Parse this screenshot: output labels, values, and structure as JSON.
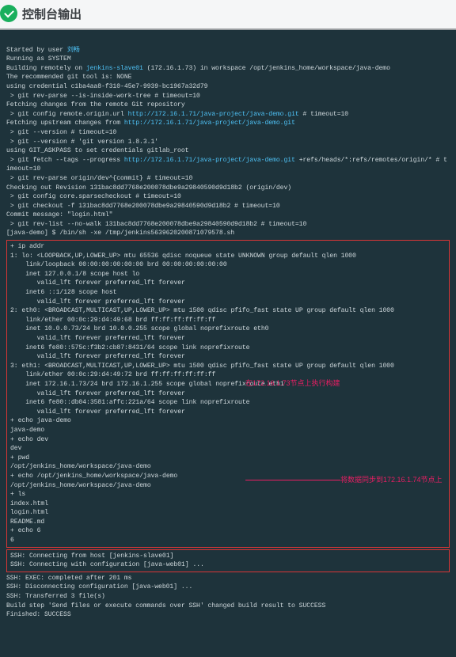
{
  "header": {
    "title": "控制台输出"
  },
  "console": {
    "l1a": "Started by user ",
    "l1b": "刘畅",
    "l2": "Running as SYSTEM",
    "l3a": "Building remotely on ",
    "l3b": "jenkins-slave01",
    "l3c": " (172.16.1.73) in workspace /opt/jenkins_home/workspace/java-demo",
    "l4": "The recommended git tool is: NONE",
    "l5": "using credential c1ba4aa8-f310-45e7-9939-bc1967a32d79",
    "l6": " > git rev-parse --is-inside-work-tree # timeout=10",
    "l7": "Fetching changes from the remote Git repository",
    "l8a": " > git config remote.origin.url ",
    "l8b": "http://172.16.1.71/java-project/java-demo.git",
    "l8c": " # timeout=10",
    "l9a": "Fetching upstream changes from ",
    "l9b": "http://172.16.1.71/java-project/java-demo.git",
    "l10": " > git --version # timeout=10",
    "l11": " > git --version # 'git version 1.8.3.1'",
    "l12": "using GIT_ASKPASS to set credentials gitlab_root",
    "l13a": " > git fetch --tags --progress ",
    "l13b": "http://172.16.1.71/java-project/java-demo.git",
    "l13c": " +refs/heads/*:refs/remotes/origin/* # timeout=10",
    "l14": " > git rev-parse origin/dev^{commit} # timeout=10",
    "l15": "Checking out Revision 131bac8dd7768e200078dbe9a29840590d9d18b2 (origin/dev)",
    "l16": " > git config core.sparsecheckout # timeout=10",
    "l17": " > git checkout -f 131bac8dd7768e200078dbe9a29840590d9d18b2 # timeout=10",
    "l18": "Commit message: \"login.html\"",
    "l19": " > git rev-list --no-walk 131bac8dd7768e200078dbe9a29840590d9d18b2 # timeout=10",
    "l20": "[java-demo] $ /bin/sh -xe /tmp/jenkins5639620200871079578.sh",
    "ip0": "+ ip addr",
    "ip1": "1: lo: <LOOPBACK,UP,LOWER_UP> mtu 65536 qdisc noqueue state UNKNOWN group default qlen 1000",
    "ip2": "    link/loopback 00:00:00:00:00:00 brd 00:00:00:00:00:00",
    "ip3": "    inet 127.0.0.1/8 scope host lo",
    "ip4": "       valid_lft forever preferred_lft forever",
    "ip5": "    inet6 ::1/128 scope host",
    "ip6": "       valid_lft forever preferred_lft forever",
    "ip7": "2: eth0: <BROADCAST,MULTICAST,UP,LOWER_UP> mtu 1500 qdisc pfifo_fast state UP group default qlen 1000",
    "ip8": "    link/ether 00:0c:29:d4:49:68 brd ff:ff:ff:ff:ff:ff",
    "ip9": "    inet 10.0.0.73/24 brd 10.0.0.255 scope global noprefixroute eth0",
    "ip10": "       valid_lft forever preferred_lft forever",
    "ip11": "    inet6 fe80::575c:f3b2:cb87:8431/64 scope link noprefixroute",
    "ip12": "       valid_lft forever preferred_lft forever",
    "ip13": "3: eth1: <BROADCAST,MULTICAST,UP,LOWER_UP> mtu 1500 qdisc pfifo_fast state UP group default qlen 1000",
    "ip14": "    link/ether 00:0c:29:d4:49:72 brd ff:ff:ff:ff:ff:ff",
    "ip15": "    inet 172.16.1.73/24 brd 172.16.1.255 scope global noprefixroute eth1",
    "ip16": "       valid_lft forever preferred_lft forever",
    "ip17": "    inet6 fe80::db04:3581:affc:221a/64 scope link noprefixroute",
    "ip18": "       valid_lft forever preferred_lft forever",
    "e1": "+ echo java-demo",
    "e2": "java-demo",
    "e3": "+ echo dev",
    "e4": "dev",
    "e5": "+ pwd",
    "e6": "/opt/jenkins_home/workspace/java-demo",
    "e7": "+ echo /opt/jenkins_home/workspace/java-demo",
    "e8": "/opt/jenkins_home/workspace/java-demo",
    "e9": "+ ls",
    "e10": "index.html",
    "e11": "login.html",
    "e12": "README.md",
    "e13": "+ echo 6",
    "e14": "6",
    "s1": "SSH: Connecting from host [jenkins-slave01]",
    "s2": "SSH: Connecting with configuration [java-web01] ...",
    "s3": "SSH: EXEC: completed after 201 ms",
    "s4": "SSH: Disconnecting configuration [java-web01] ...",
    "s5": "SSH: Transferred 3 file(s)",
    "s6": "Build step 'Send files or execute commands over SSH' changed build result to SUCCESS",
    "s7": "Finished: SUCCESS"
  },
  "annotations": {
    "a1": "在172.16.1.73节点上执行构建",
    "a2": "将数据同步到172.16.1.74节点上"
  }
}
